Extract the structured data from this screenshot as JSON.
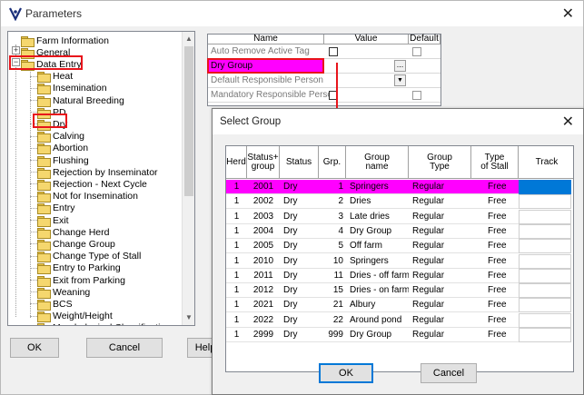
{
  "window": {
    "title": "Parameters"
  },
  "tree": {
    "items": [
      {
        "label": "Farm Information"
      },
      {
        "label": "General"
      },
      {
        "label": "Data Entry"
      },
      {
        "label": "Heat"
      },
      {
        "label": "Insemination"
      },
      {
        "label": "Natural Breeding"
      },
      {
        "label": "PD"
      },
      {
        "label": "Dry"
      },
      {
        "label": "Calving"
      },
      {
        "label": "Abortion"
      },
      {
        "label": "Flushing"
      },
      {
        "label": "Rejection by Inseminator"
      },
      {
        "label": "Rejection - Next Cycle"
      },
      {
        "label": "Not for Insemination"
      },
      {
        "label": "Entry"
      },
      {
        "label": "Exit"
      },
      {
        "label": "Change Herd"
      },
      {
        "label": "Change Group"
      },
      {
        "label": "Change Type of Stall"
      },
      {
        "label": "Entry to Parking"
      },
      {
        "label": "Exit from Parking"
      },
      {
        "label": "Weaning"
      },
      {
        "label": "BCS"
      },
      {
        "label": "Weight/Height"
      },
      {
        "label": "Morphological Classifications"
      }
    ]
  },
  "params": {
    "headers": {
      "name": "Name",
      "value": "Value",
      "default": "Default"
    },
    "rows": [
      {
        "label": "Auto Remove Active Tag"
      },
      {
        "label": "Dry Group"
      },
      {
        "label": "Default Responsible Person"
      },
      {
        "label": "Mandatory Responsible Person"
      }
    ]
  },
  "buttons": {
    "ok": "OK",
    "cancel": "Cancel",
    "help": "Help"
  },
  "dialog": {
    "title": "Select Group",
    "headers": {
      "herd": "Herd",
      "status_group": "Status+\ngroup",
      "status": "Status",
      "grp": "Grp.",
      "group_name": "Group\nname",
      "group_type": "Group\nType",
      "stall": "Type\nof Stall",
      "track": "Track"
    },
    "rows": [
      {
        "herd": "1",
        "sg": "2001",
        "status": "Dry",
        "grp": "1",
        "name": "Springers",
        "type": "Regular",
        "stall": "Free"
      },
      {
        "herd": "1",
        "sg": "2002",
        "status": "Dry",
        "grp": "2",
        "name": "Dries",
        "type": "Regular",
        "stall": "Free"
      },
      {
        "herd": "1",
        "sg": "2003",
        "status": "Dry",
        "grp": "3",
        "name": "Late dries",
        "type": "Regular",
        "stall": "Free"
      },
      {
        "herd": "1",
        "sg": "2004",
        "status": "Dry",
        "grp": "4",
        "name": "Dry Group",
        "type": "Regular",
        "stall": "Free"
      },
      {
        "herd": "1",
        "sg": "2005",
        "status": "Dry",
        "grp": "5",
        "name": "Off farm",
        "type": "Regular",
        "stall": "Free"
      },
      {
        "herd": "1",
        "sg": "2010",
        "status": "Dry",
        "grp": "10",
        "name": "Springers",
        "type": "Regular",
        "stall": "Free"
      },
      {
        "herd": "1",
        "sg": "2011",
        "status": "Dry",
        "grp": "11",
        "name": "Dries - off farm",
        "type": "Regular",
        "stall": "Free"
      },
      {
        "herd": "1",
        "sg": "2012",
        "status": "Dry",
        "grp": "15",
        "name": "Dries - on farm",
        "type": "Regular",
        "stall": "Free"
      },
      {
        "herd": "1",
        "sg": "2021",
        "status": "Dry",
        "grp": "21",
        "name": "Albury",
        "type": "Regular",
        "stall": "Free"
      },
      {
        "herd": "1",
        "sg": "2022",
        "status": "Dry",
        "grp": "22",
        "name": "Around pond",
        "type": "Regular",
        "stall": "Free"
      },
      {
        "herd": "1",
        "sg": "2999",
        "status": "Dry",
        "grp": "999",
        "name": "Dry Group",
        "type": "Regular",
        "stall": "Free"
      }
    ],
    "ok": "OK",
    "cancel": "Cancel"
  },
  "colors": {
    "highlight": "#ff00ff",
    "track_selected": "#0078d7",
    "annotation": "#e8141b"
  }
}
